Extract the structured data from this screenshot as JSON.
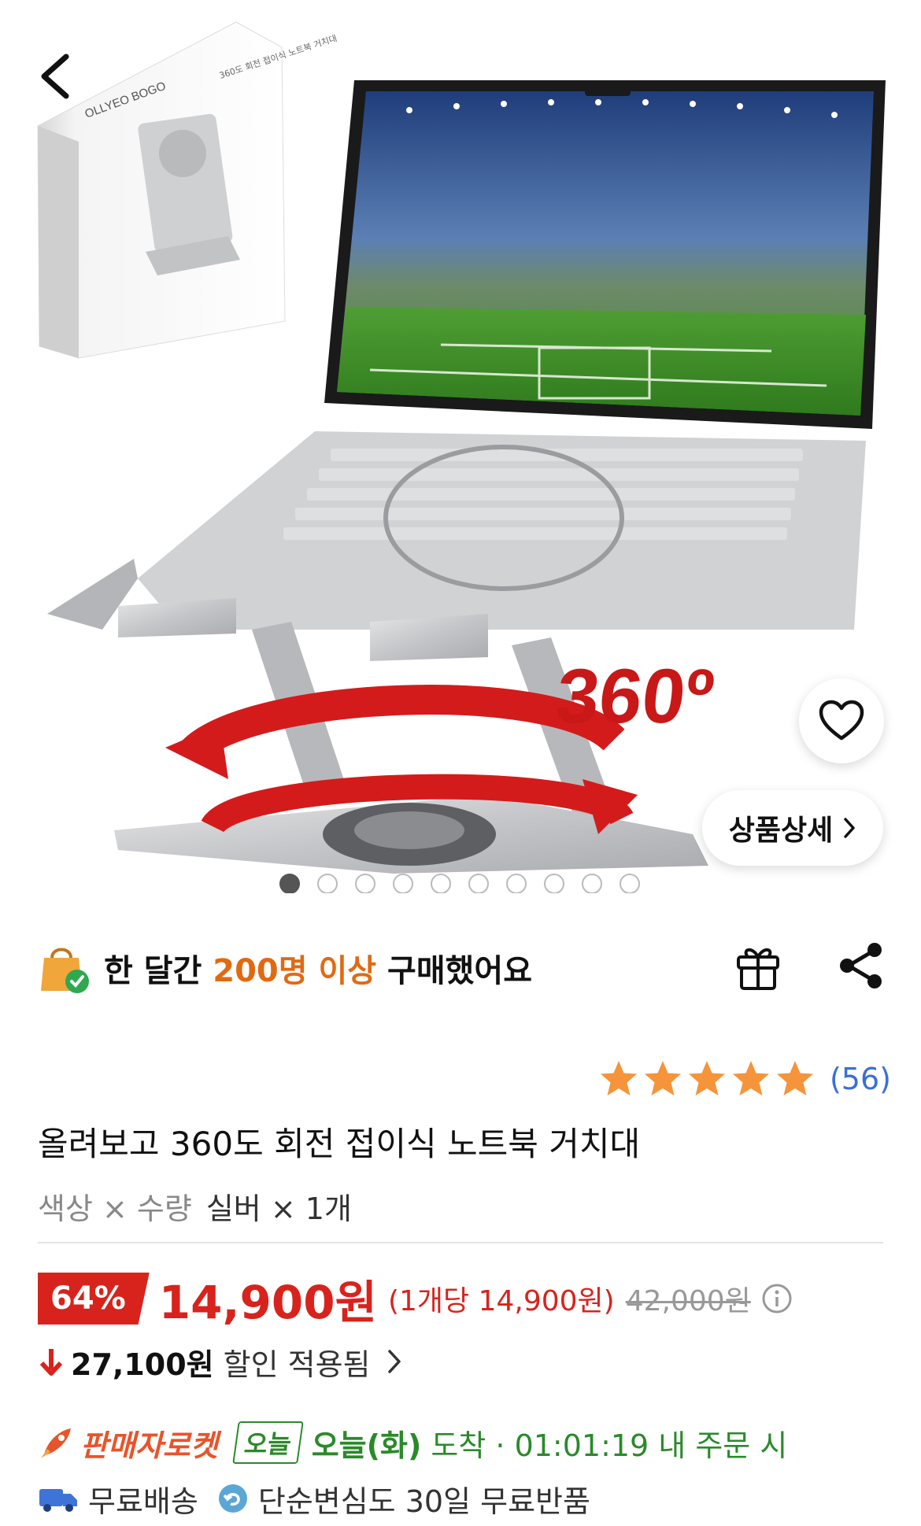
{
  "product_image": {
    "box_brand": "OLLYEO BOGO",
    "box_caption": "360도 회전 접이식 노트북 거치대",
    "rotation_label": "360º",
    "carousel_count": 10,
    "carousel_active_index": 0
  },
  "overlay": {
    "detail_label": "상품상세"
  },
  "social_proof": {
    "prefix": "한 달간 ",
    "highlight": "200명 이상",
    "suffix": " 구매했어요"
  },
  "rating": {
    "stars": 5,
    "count": "(56)"
  },
  "product": {
    "title": "올려보고 360도 회전 접이식 노트북 거치대",
    "option_label": "색상 × 수량",
    "option_value": "실버 × 1개"
  },
  "price": {
    "discount_rate": "64%",
    "sale_price": "14,900원",
    "unit_price": "(1개당 14,900원)",
    "original_price": "42,000원",
    "discount_amount": "27,100원",
    "discount_text": "할인 적용됨"
  },
  "shipping": {
    "rocket_label": "판매자로켓",
    "today_badge": "오늘",
    "arrival_day": "오늘(화)",
    "arrival_text": " 도착 · 01:01:19 내 주문 시",
    "free_shipping": "무료배송",
    "return_policy": "단순변심도 30일 무료반품"
  },
  "colors": {
    "accent_red": "#d8231d",
    "highlight_orange": "#e06a12",
    "arrival_green": "#2a8a2a",
    "rating_blue": "#3a6fd8",
    "star_orange": "#f5943b"
  }
}
